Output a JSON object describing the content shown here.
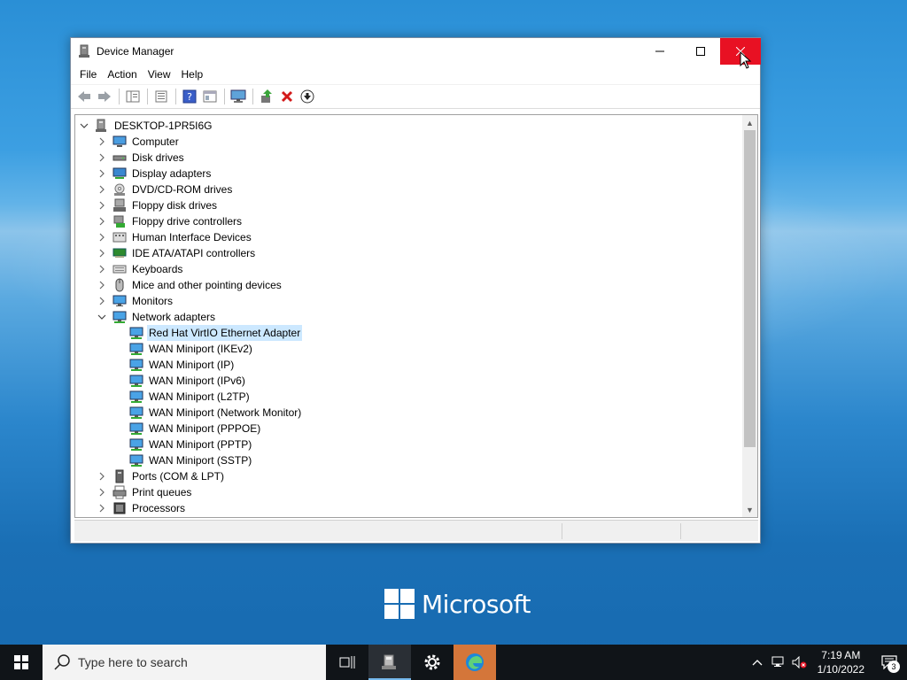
{
  "window": {
    "title": "Device Manager",
    "minimize_glyph": "—",
    "maximize_glyph": "☐",
    "close_glyph": "✕"
  },
  "menu": [
    "File",
    "Action",
    "View",
    "Help"
  ],
  "toolbar": {
    "buttons": [
      "back-icon",
      "forward-icon",
      "show-hide-console-tree-icon",
      "properties-icon",
      "help-icon",
      "view-icon",
      "monitor-icon",
      "update-driver-icon",
      "uninstall-icon",
      "disable-device-icon"
    ]
  },
  "tree": {
    "root": "DESKTOP-1PR5I6G",
    "items": [
      {
        "label": "Computer",
        "icon": "computer-icon",
        "expanded": false
      },
      {
        "label": "Disk drives",
        "icon": "disk-drive-icon",
        "expanded": false
      },
      {
        "label": "Display adapters",
        "icon": "display-adapter-icon",
        "expanded": false
      },
      {
        "label": "DVD/CD-ROM drives",
        "icon": "dvd-drive-icon",
        "expanded": false
      },
      {
        "label": "Floppy disk drives",
        "icon": "floppy-disk-icon",
        "expanded": false
      },
      {
        "label": "Floppy drive controllers",
        "icon": "floppy-controller-icon",
        "expanded": false
      },
      {
        "label": "Human Interface Devices",
        "icon": "hid-icon",
        "expanded": false
      },
      {
        "label": "IDE ATA/ATAPI controllers",
        "icon": "ide-controller-icon",
        "expanded": false
      },
      {
        "label": "Keyboards",
        "icon": "keyboard-icon",
        "expanded": false
      },
      {
        "label": "Mice and other pointing devices",
        "icon": "mouse-icon",
        "expanded": false
      },
      {
        "label": "Monitors",
        "icon": "monitor-icon",
        "expanded": false
      },
      {
        "label": "Network adapters",
        "icon": "network-adapter-icon",
        "expanded": true,
        "children": [
          {
            "label": "Red Hat VirtIO Ethernet Adapter",
            "selected": true
          },
          {
            "label": "WAN Miniport (IKEv2)"
          },
          {
            "label": "WAN Miniport (IP)"
          },
          {
            "label": "WAN Miniport (IPv6)"
          },
          {
            "label": "WAN Miniport (L2TP)"
          },
          {
            "label": "WAN Miniport (Network Monitor)"
          },
          {
            "label": "WAN Miniport (PPPOE)"
          },
          {
            "label": "WAN Miniport (PPTP)"
          },
          {
            "label": "WAN Miniport (SSTP)"
          }
        ]
      },
      {
        "label": "Ports (COM & LPT)",
        "icon": "port-icon",
        "expanded": false
      },
      {
        "label": "Print queues",
        "icon": "printer-icon",
        "expanded": false
      },
      {
        "label": "Processors",
        "icon": "processor-icon",
        "expanded": false
      }
    ]
  },
  "desktop": {
    "brand": "Microsoft"
  },
  "taskbar": {
    "search_placeholder": "Type here to search",
    "time": "7:19 AM",
    "date": "1/10/2022",
    "notification_count": "3"
  },
  "colors": {
    "close_red": "#e81123",
    "selection": "#cce8ff",
    "taskbar": "#101418"
  }
}
